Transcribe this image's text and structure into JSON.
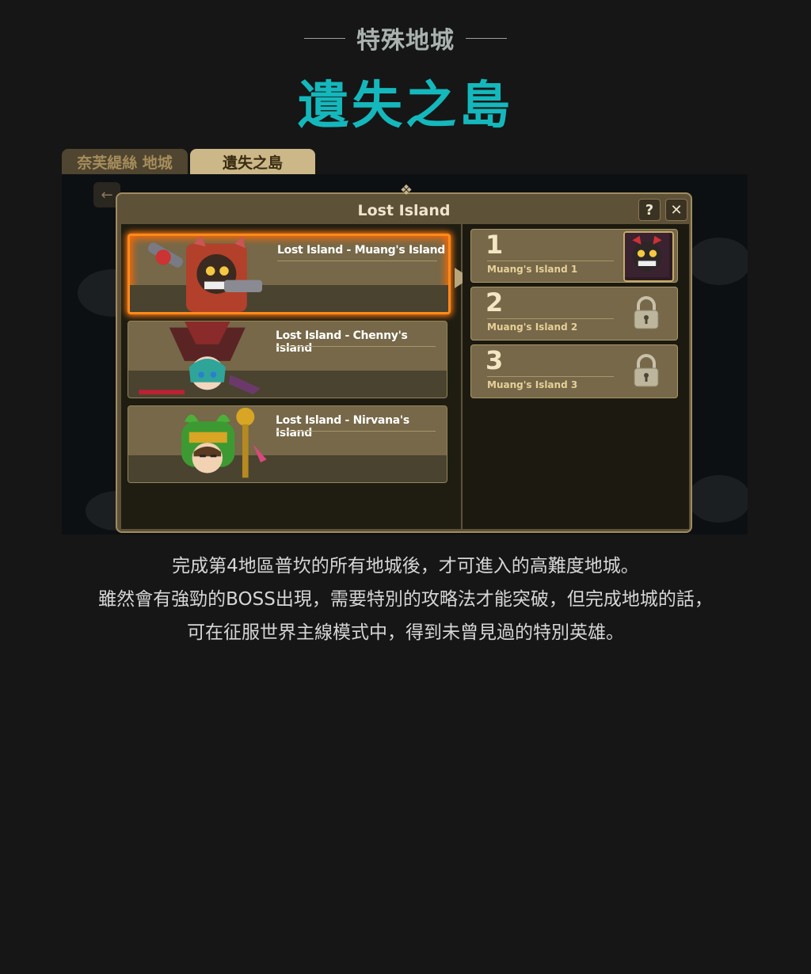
{
  "header": {
    "subtitle": "特殊地城",
    "title": "遺失之島"
  },
  "tabs": [
    {
      "label": "奈芙緹絲 地城",
      "active": false
    },
    {
      "label": "遺失之島",
      "active": true
    }
  ],
  "dialog": {
    "title": "Lost Island",
    "help_label": "?",
    "close_label": "✕",
    "dungeons": [
      {
        "label": "Lost Island - Muang's Island",
        "selected": true
      },
      {
        "label": "Lost Island - Chenny's Island",
        "selected": false
      },
      {
        "label": "Lost Island - Nirvana's Island",
        "selected": false
      }
    ],
    "stages": [
      {
        "number": "1",
        "name": "Muang's Island 1",
        "locked": false
      },
      {
        "number": "2",
        "name": "Muang's Island 2",
        "locked": true
      },
      {
        "number": "3",
        "name": "Muang's Island 3",
        "locked": true
      }
    ]
  },
  "description": [
    "完成第4地區普坎的所有地城後，才可進入的高難度地城。",
    "雖然會有強勁的BOSS出現，需要特別的攻略法才能突破，但完成地城的話，",
    "可在征服世界主線模式中，得到未曾見過的特別英雄。"
  ],
  "colors": {
    "title_accent": "#14b8bc",
    "selected_glow": "#ff8a1a",
    "panel_brown": "#766848"
  }
}
